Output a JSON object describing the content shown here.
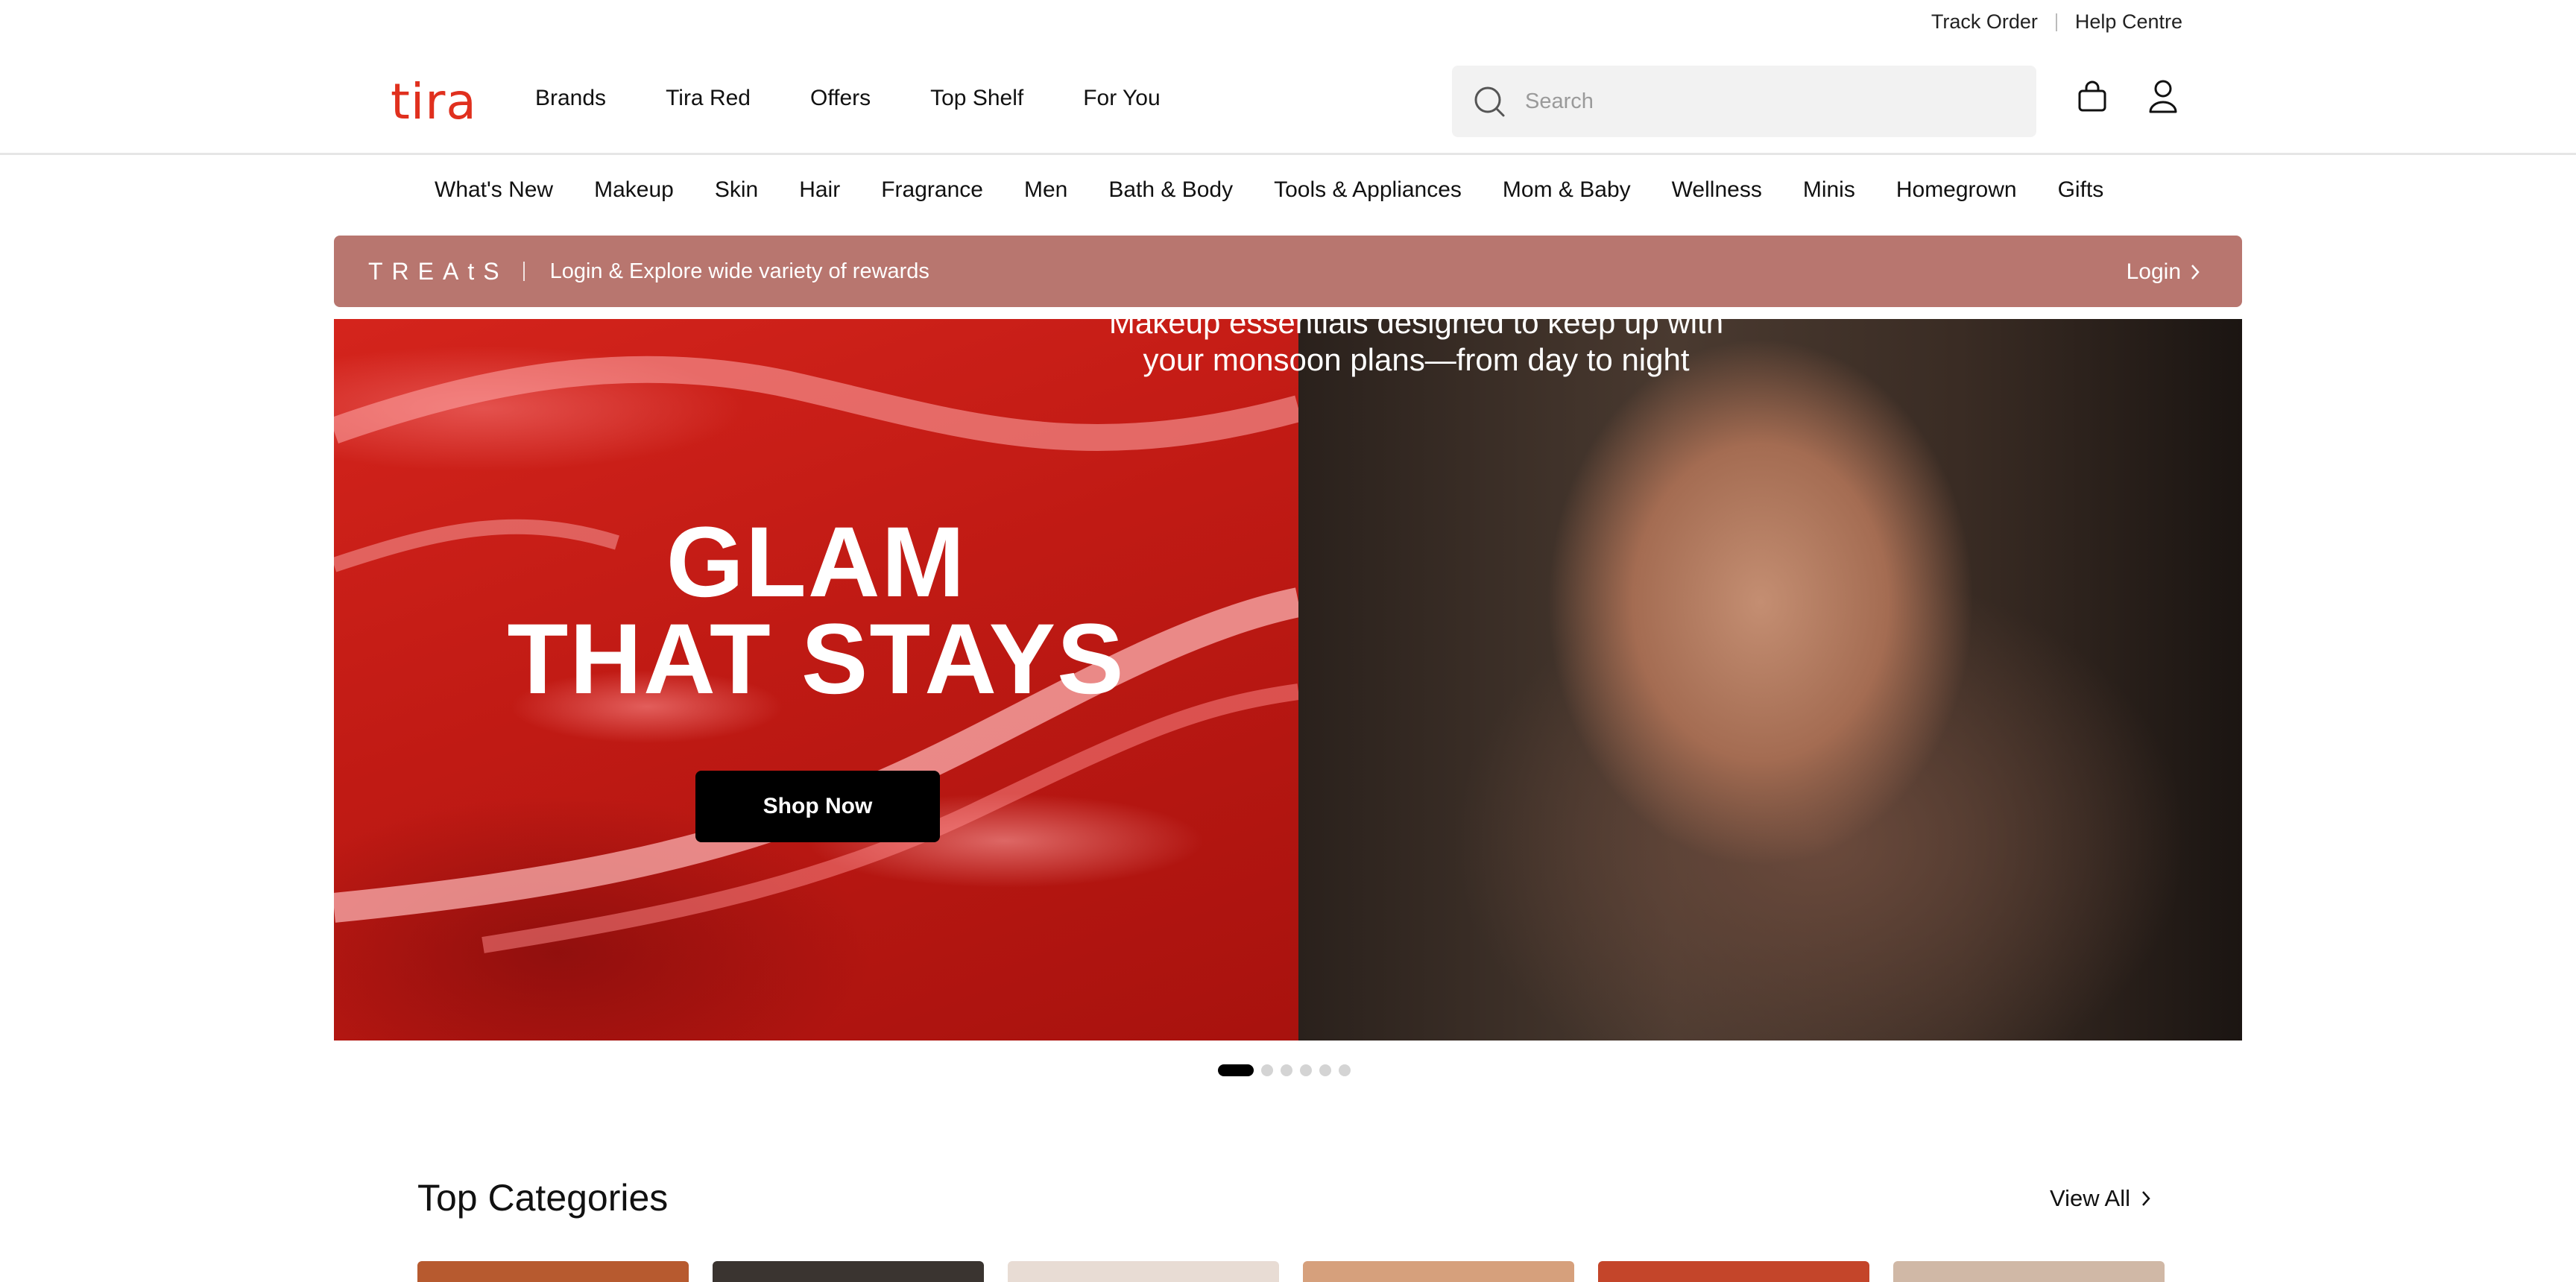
{
  "utility": {
    "track_order": "Track Order",
    "help_centre": "Help Centre"
  },
  "header": {
    "logo": "tira",
    "nav": [
      "Brands",
      "Tira Red",
      "Offers",
      "Top Shelf",
      "For You"
    ],
    "search_placeholder": "Search"
  },
  "categories": [
    "What's New",
    "Makeup",
    "Skin",
    "Hair",
    "Fragrance",
    "Men",
    "Bath & Body",
    "Tools & Appliances",
    "Mom & Baby",
    "Wellness",
    "Minis",
    "Homegrown",
    "Gifts"
  ],
  "treats": {
    "brand": "TREAtS",
    "message": "Login & Explore wide variety of rewards",
    "login": "Login"
  },
  "hero": {
    "title_line1": "GLAM",
    "title_line2": "THAT STAYS",
    "cta": "Shop Now",
    "subtitle": "Makeup essentials designed to keep up with your monsoon plans—from day to night",
    "slides": 6,
    "active_slide": 1
  },
  "top_categories": {
    "title": "Top Categories",
    "view_all": "View All",
    "card_colors": [
      "#b75a2f",
      "#3a3430",
      "#e8dcd4",
      "#d6a07c",
      "#c4452a",
      "#d0b8a6"
    ]
  },
  "colors": {
    "brand": "#e0301e",
    "treats_bg": "#b8766f"
  }
}
